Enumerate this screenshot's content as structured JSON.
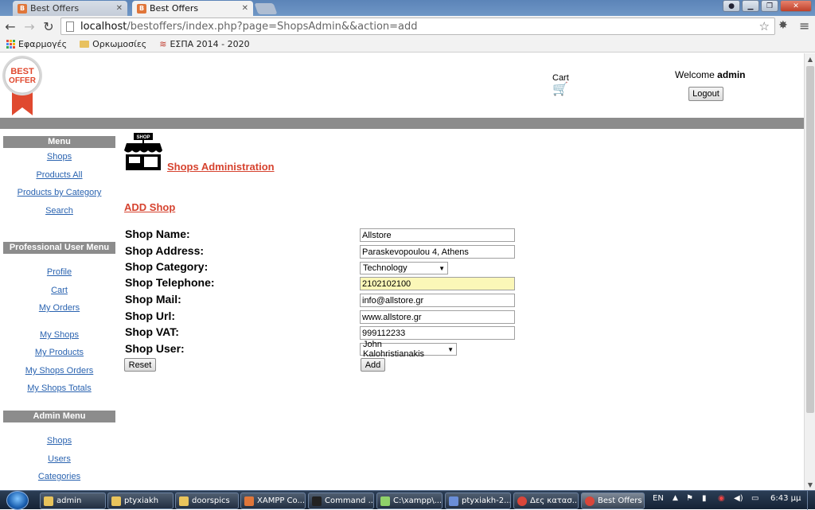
{
  "browser": {
    "tabs": [
      {
        "label": "Best Offers",
        "active": false
      },
      {
        "label": "Best Offers",
        "active": true
      }
    ],
    "url_host": "localhost",
    "url_path": "/bestoffers/index.php?page=ShopsAdmin&&action=add",
    "bookmarks": [
      "Εφαρμογές",
      "Ορκωμοσίες",
      "ΕΣΠΑ 2014 - 2020"
    ]
  },
  "header": {
    "logo_line1": "BEST",
    "logo_line2": "OFFER",
    "cart_label": "Cart",
    "welcome_text": "Welcome ",
    "welcome_user": "admin",
    "logout_label": "Logout"
  },
  "sidebar": {
    "menu_title": "Menu",
    "menu_items": [
      "Shops",
      "Products All",
      "Products by Category",
      "Search"
    ],
    "pro_title": "Professional User Menu",
    "pro_items": [
      "Profile",
      "Cart",
      "My Orders",
      "My Shops",
      "My Products",
      "My Shops Orders",
      "My Shops Totals"
    ],
    "admin_title": "Admin Menu",
    "admin_items": [
      "Shops",
      "Users",
      "Categories"
    ]
  },
  "main": {
    "shop_icon_label": "SHOP",
    "title": "Shops Administration",
    "subtitle": "ADD Shop",
    "fields": {
      "name_label": "Shop Name:",
      "name_value": "Allstore",
      "address_label": "Shop Address:",
      "address_value": "Paraskevopoulou 4, Athens",
      "category_label": "Shop Category:",
      "category_value": "Technology",
      "telephone_label": "Shop Telephone:",
      "telephone_value": "2102102100",
      "mail_label": "Shop Mail:",
      "mail_value": "info@allstore.gr",
      "url_label": "Shop Url:",
      "url_value": "www.allstore.gr",
      "vat_label": "Shop VAT:",
      "vat_value": "999112233",
      "user_label": "Shop User:",
      "user_value": "John Kalohristianakis"
    },
    "reset_label": "Reset",
    "add_label": "Add"
  },
  "taskbar": {
    "tasks": [
      "admin",
      "ptyxiakh",
      "doorspics",
      "XAMPP Co...",
      "Command ...",
      "C:\\xampp\\...",
      "ptyxiakh-2...",
      "Δες κατασ...",
      "Best Offers ..."
    ],
    "lang": "EN",
    "time": "6:43 μμ"
  },
  "colors": {
    "accent_red": "#d6432f",
    "link_blue": "#2a63b0",
    "band_grey": "#8c8c8c",
    "highlight_yellow": "#fbf7b8"
  }
}
